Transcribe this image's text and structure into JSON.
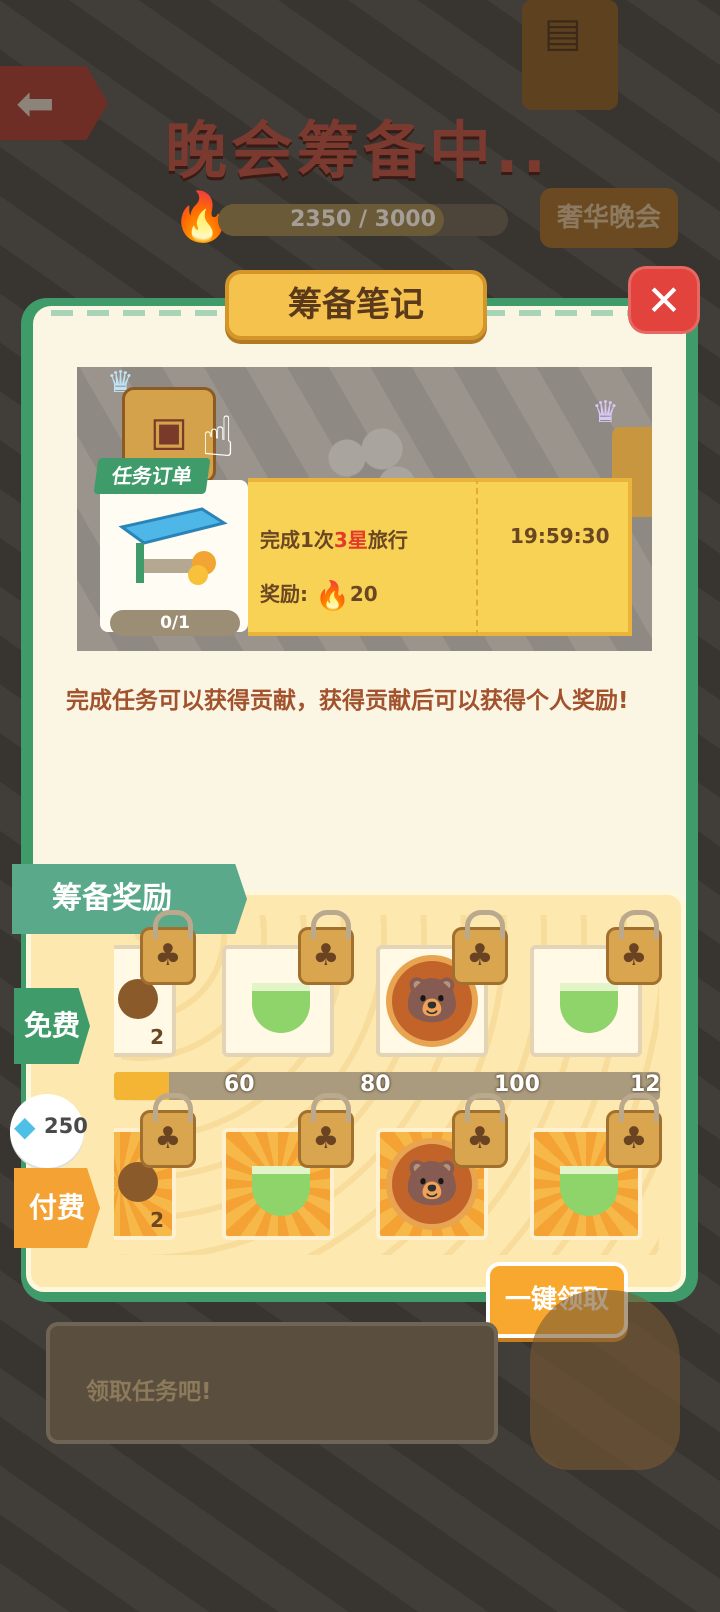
{
  "background": {
    "title": "晚会筹备中..",
    "progress_text": "2350 / 3000",
    "progress_fraction": 0.78,
    "luxury_button": "奢华晚会"
  },
  "panel": {
    "title": "筹备笔记",
    "close_icon": "close-icon",
    "order": {
      "tag": "任务订单",
      "count": "0/1",
      "task_prefix": "完成1次",
      "task_highlight": "3星",
      "task_suffix": "旅行",
      "reward_label": "奖励:",
      "reward_value": "20",
      "timer": "19:59:30"
    },
    "description": "完成任务可以获得贡献，获得贡献后可以获得个人奖励!"
  },
  "rewards": {
    "label": "筹备奖励",
    "free_label": "免费",
    "paid_label": "付费",
    "gem_count": "250",
    "progress_fraction": 0.1,
    "ticks": [
      "60",
      "80",
      "100",
      "12"
    ],
    "free_items": [
      {
        "icon": "acorn-icon",
        "count": "2"
      },
      {
        "icon": "soup-bowl-icon",
        "count": ""
      },
      {
        "icon": "bear-medal-icon",
        "count": ""
      },
      {
        "icon": "soup-bowl-icon",
        "count": ""
      }
    ],
    "paid_items": [
      {
        "icon": "acorn-icon",
        "count": "2"
      },
      {
        "icon": "soup-bowl-icon",
        "count": ""
      },
      {
        "icon": "bear-medal-icon",
        "count": ""
      },
      {
        "icon": "soup-bowl-icon",
        "count": ""
      }
    ],
    "collect_all": "一键领取"
  },
  "dialog": {
    "text": "领取任务吧!"
  },
  "colors": {
    "panel_green": "#3f9c6a",
    "accent_orange": "#f8a82f",
    "highlight_red": "#e33a2b"
  }
}
